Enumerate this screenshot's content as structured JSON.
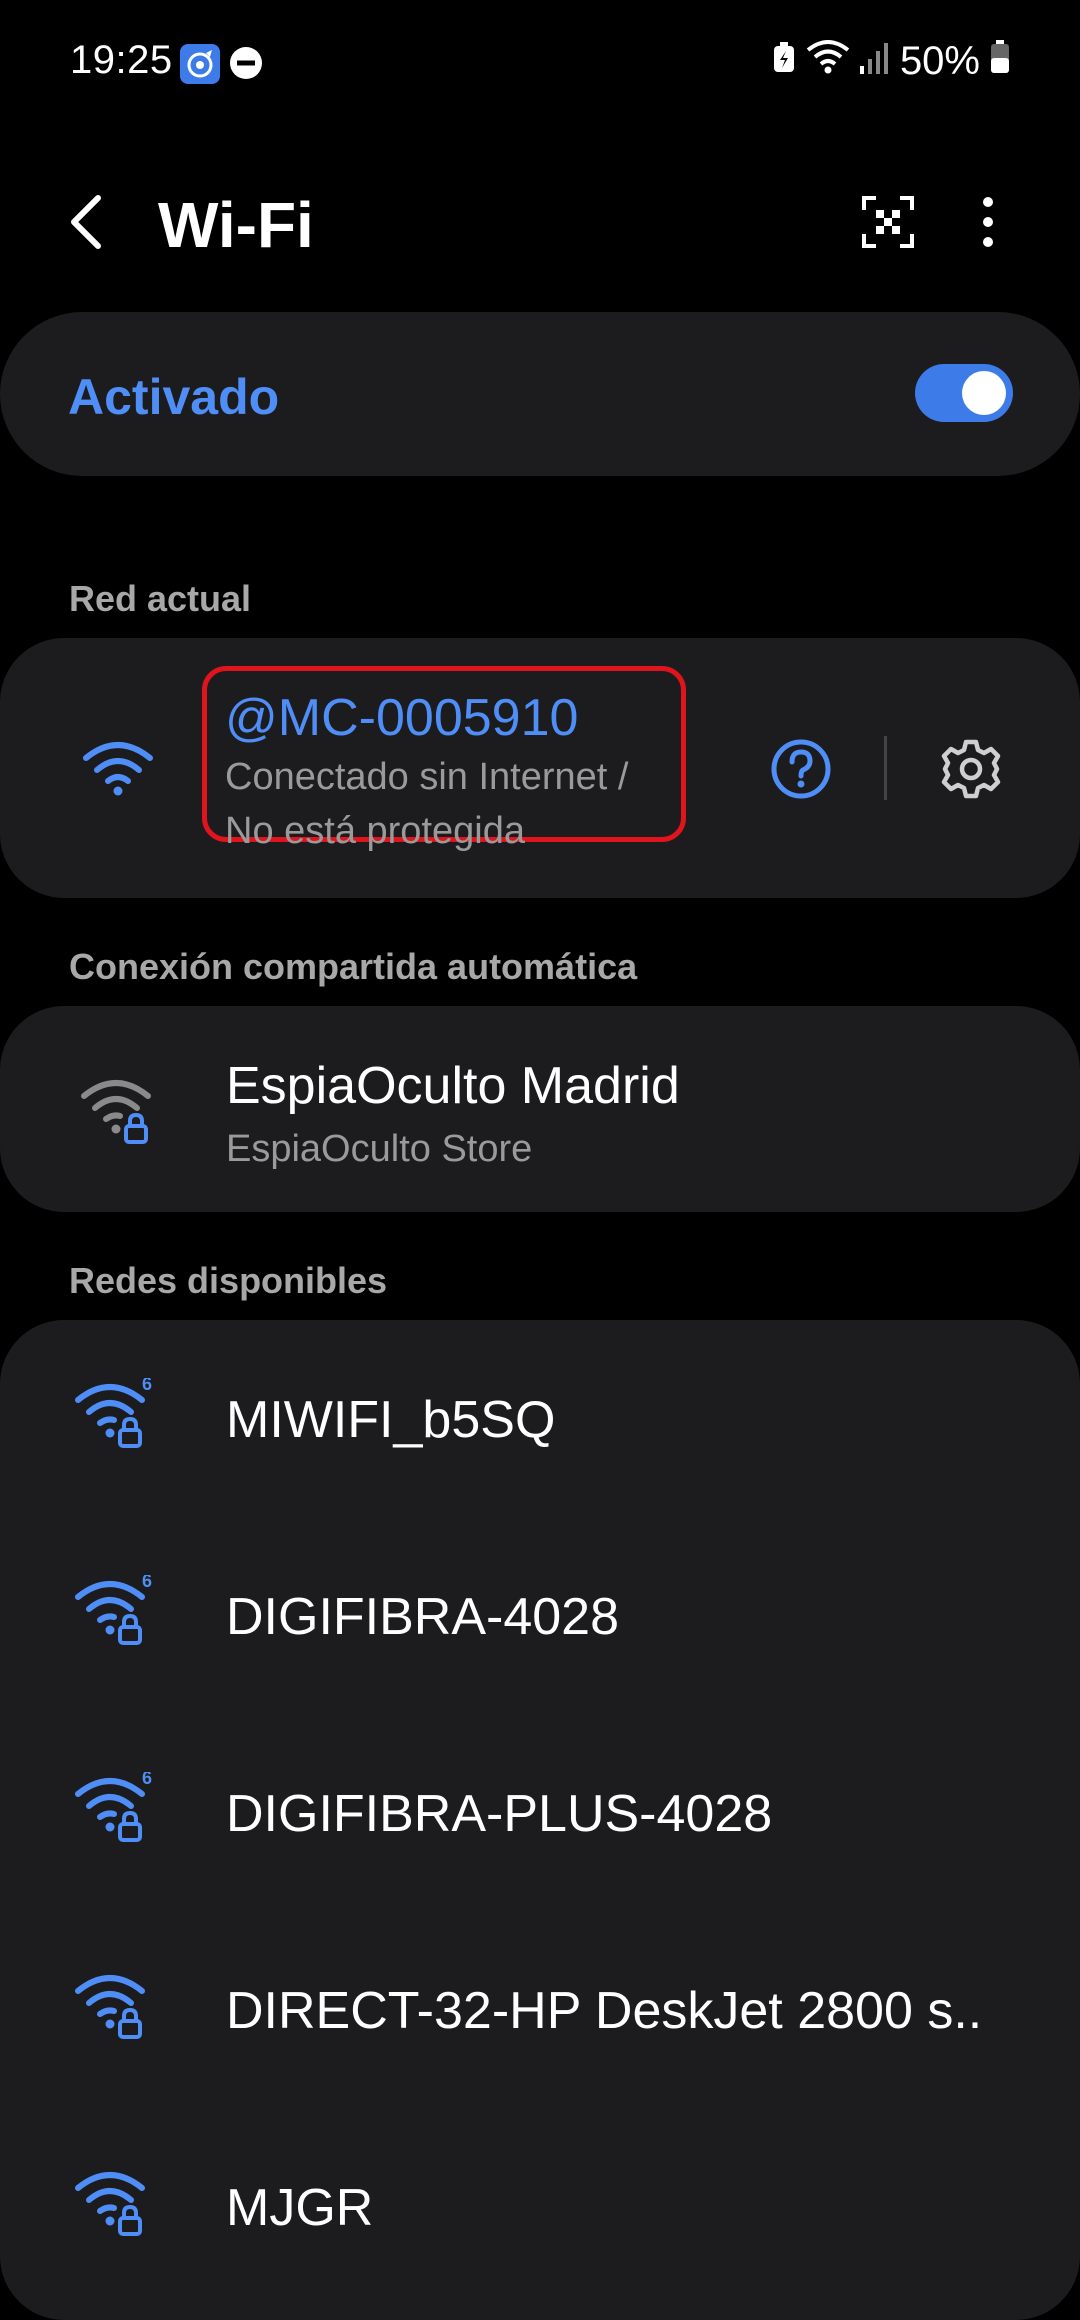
{
  "status_bar": {
    "time": "19:25",
    "battery": "50%"
  },
  "header": {
    "title": "Wi-Fi"
  },
  "wifi_toggle": {
    "label": "Activado",
    "state": "on"
  },
  "current_network": {
    "section_label": "Red actual",
    "name": "@MC-0005910",
    "status_line1": "Conectado sin Internet /",
    "status_line2": "No está protegida"
  },
  "auto_hotspot": {
    "section_label": "Conexión compartida automática",
    "name": "EspiaOculto Madrid",
    "subtitle": "EspiaOculto Store"
  },
  "available_networks": {
    "section_label": "Redes disponibles",
    "items": [
      {
        "name": "MIWIFI_b5SQ",
        "badge": "6"
      },
      {
        "name": "DIGIFIBRA-4028",
        "badge": "6"
      },
      {
        "name": "DIGIFIBRA-PLUS-4028",
        "badge": "6"
      },
      {
        "name": "DIRECT-32-HP DeskJet 2800 s..",
        "badge": ""
      },
      {
        "name": "MJGR",
        "badge": ""
      }
    ]
  },
  "colors": {
    "accent": "#4f8ef7",
    "card": "#1c1c1e",
    "highlight": "#e0141c"
  }
}
